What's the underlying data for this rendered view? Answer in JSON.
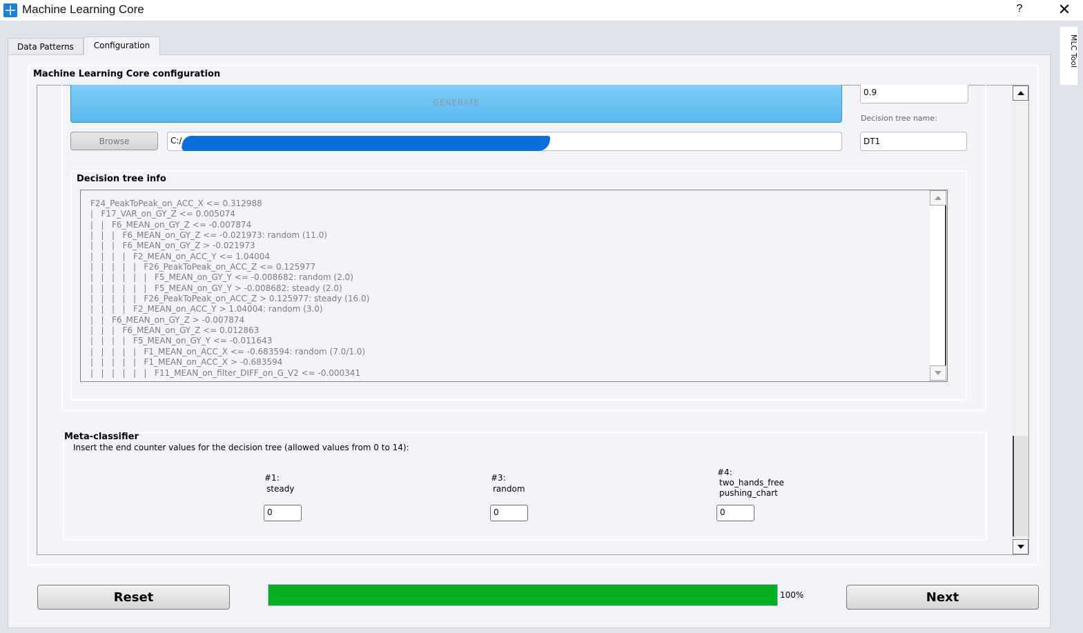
{
  "window": {
    "title": "Machine Learning Core",
    "help_label": "?",
    "close_label": "✕",
    "icon": "app-grid-icon"
  },
  "side_tab": {
    "label": "MLC Tool"
  },
  "tabs": [
    {
      "label": "Data Patterns",
      "active": false
    },
    {
      "label": "Configuration",
      "active": true
    }
  ],
  "config": {
    "group_title": "Machine Learning Core configuration",
    "generate_label": "GENERATE",
    "browse_label": "Browse",
    "path_value": "C:/",
    "threshold_value": "0.9",
    "dt_name_label": "Decision tree name:",
    "dt_name_value": "DT1"
  },
  "decision_tree": {
    "title": "Decision tree info",
    "lines": [
      "F24_PeakToPeak_on_ACC_X <= 0.312988",
      "|   F17_VAR_on_GY_Z <= 0.005074",
      "|   |   F6_MEAN_on_GY_Z <= -0.007874",
      "|   |   |   F6_MEAN_on_GY_Z <= -0.021973: random (11.0)",
      "|   |   |   F6_MEAN_on_GY_Z > -0.021973",
      "|   |   |   |   F2_MEAN_on_ACC_Y <= 1.04004",
      "|   |   |   |   |   F26_PeakToPeak_on_ACC_Z <= 0.125977",
      "|   |   |   |   |   |   F5_MEAN_on_GY_Y <= -0.008682: random (2.0)",
      "|   |   |   |   |   |   F5_MEAN_on_GY_Y > -0.008682: steady (2.0)",
      "|   |   |   |   |   F26_PeakToPeak_on_ACC_Z > 0.125977: steady (16.0)",
      "|   |   |   |   F2_MEAN_on_ACC_Y > 1.04004: random (3.0)",
      "|   |   F6_MEAN_on_GY_Z > -0.007874",
      "|   |   |   F6_MEAN_on_GY_Z <= 0.012863",
      "|   |   |   |   F5_MEAN_on_GY_Y <= -0.011643",
      "|   |   |   |   |   F1_MEAN_on_ACC_X <= -0.683594: random (7.0/1.0)",
      "|   |   |   |   |   F1_MEAN_on_ACC_X > -0.683594",
      "|   |   |   |   |   |   F11_MEAN_on_filter_DIFF_on_G_V2 <= -0.000341"
    ]
  },
  "meta_classifier": {
    "title": "Meta-classifier",
    "description": "Insert the end counter values for the decision tree (allowed values from 0 to 14):",
    "classes": [
      {
        "id": "#1:",
        "name": "steady",
        "value": "0"
      },
      {
        "id": "#3:",
        "name": "random",
        "value": "0"
      },
      {
        "id": "#4:",
        "name": "two_hands_free\npushing_chart",
        "value": "0"
      }
    ]
  },
  "footer": {
    "reset_label": "Reset",
    "next_label": "Next",
    "progress_percent": 100,
    "progress_text": "100%",
    "progress_color": "#06b025"
  }
}
